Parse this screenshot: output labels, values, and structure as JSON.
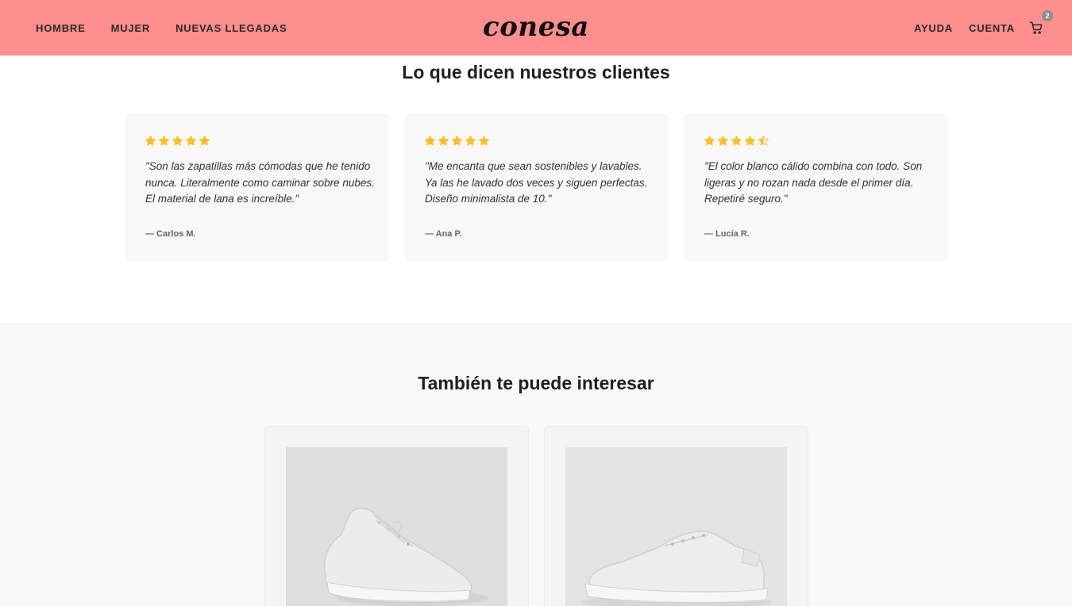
{
  "header": {
    "nav_left": [
      "HOMBRE",
      "MUJER",
      "NUEVAS LLEGADAS"
    ],
    "logo": "conesa",
    "nav_right": [
      "AYUDA",
      "CUENTA"
    ],
    "cart_count": "2",
    "background_color": "#ff8e8e"
  },
  "reviews": {
    "title": "Lo que dicen nuestros clientes",
    "star_color": "#fbbf24",
    "items": [
      {
        "rating": 5,
        "text": "\"Son las zapatillas más cómodas que he tenido nunca. Literalmente como caminar sobre nubes. El material de lana es increíble.\"",
        "author": "— Carlos M."
      },
      {
        "rating": 5,
        "text": "\"Me encanta que sean sostenibles y lavables. Ya las he lavado dos veces y siguen perfectas. Diseño minimalista de 10.\"",
        "author": "— Ana P."
      },
      {
        "rating": 4.5,
        "text": "\"El color blanco cálido combina con todo. Son ligeras y no rozan nada desde el primer día. Repetiré seguro.\"",
        "author": "— Lucía R."
      }
    ]
  },
  "related": {
    "title": "También te puede interesar",
    "products": [
      {
        "icon": "wool-runner-sneaker-image"
      },
      {
        "icon": "wool-lounger-sneaker-image"
      }
    ]
  }
}
